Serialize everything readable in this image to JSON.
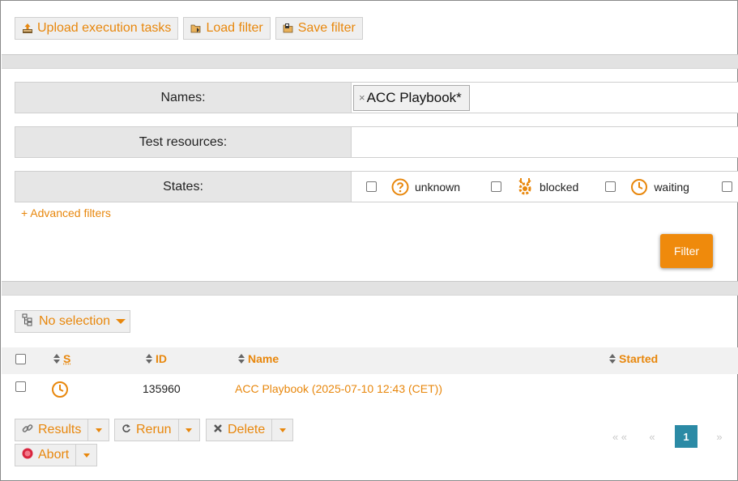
{
  "toolbar": {
    "upload_label": "Upload execution tasks",
    "load_label": "Load filter",
    "save_label": "Save filter"
  },
  "filters": {
    "names_label": "Names:",
    "names_chip": "ACC Playbook*",
    "names_chip_remove": "×",
    "test_resources_label": "Test resources:",
    "states_label": "States:",
    "states": [
      {
        "label": "unknown",
        "icon": "question-circle-icon"
      },
      {
        "label": "blocked",
        "icon": "blocked-gear-icon"
      },
      {
        "label": "waiting",
        "icon": "clock-icon"
      }
    ],
    "advanced_label": "+ Advanced filters",
    "filter_button": "Filter"
  },
  "selection": {
    "label": "No selection"
  },
  "table": {
    "columns": [
      "S",
      "ID",
      "Name",
      "Started"
    ],
    "rows": [
      {
        "state_icon": "clock-icon",
        "id": "135960",
        "name": "ACC Playbook (2025-07-10 12:43 (CET))",
        "started": ""
      }
    ]
  },
  "actions": {
    "results": "Results",
    "rerun": "Rerun",
    "delete": "Delete",
    "abort": "Abort"
  },
  "pagination": {
    "first": "« «",
    "prev": "«",
    "current": "1",
    "next": "»"
  },
  "colors": {
    "accent": "#e8870c",
    "filter_button": "#ef8a0c",
    "page_active": "#2b8aa5",
    "label_bg": "#e6e6e6"
  }
}
